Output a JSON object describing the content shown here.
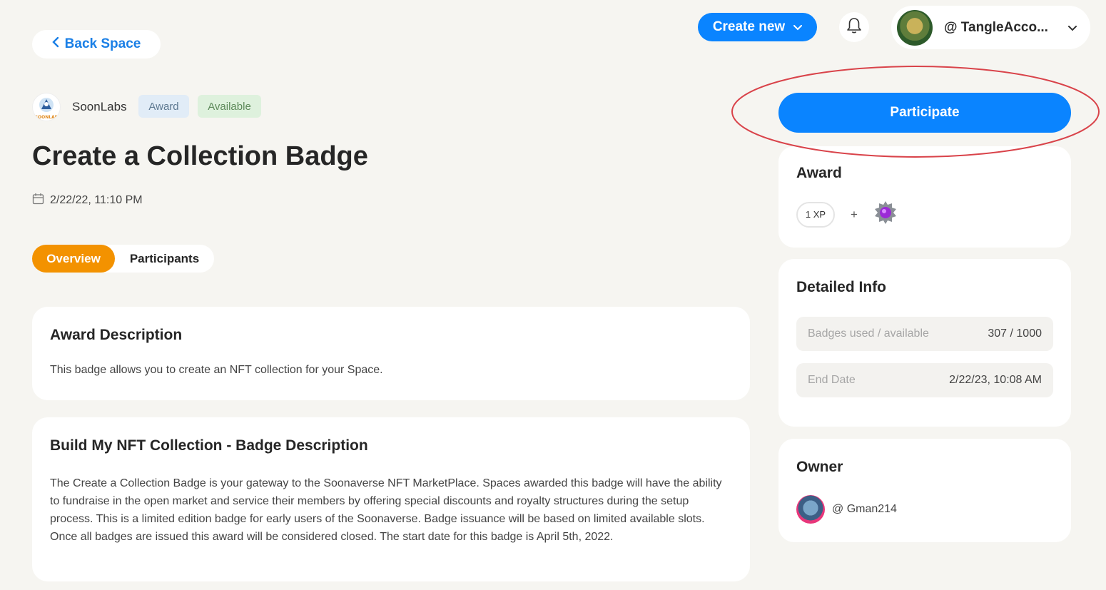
{
  "header": {
    "back_label": "Back Space",
    "create_label": "Create new",
    "account_name": "@ TangleAcco..."
  },
  "space": {
    "name": "SoonLabs",
    "logo_text": "SOONLAB",
    "tags": [
      "Award",
      "Available"
    ]
  },
  "page": {
    "title": "Create a Collection Badge",
    "date": "2/22/22, 11:10 PM"
  },
  "tabs": [
    {
      "label": "Overview",
      "active": true
    },
    {
      "label": "Participants",
      "active": false
    }
  ],
  "award_description": {
    "heading": "Award Description",
    "text": "This badge allows you to create an NFT collection for your Space."
  },
  "badge_description": {
    "heading": "Build My NFT Collection - Badge Description",
    "text": "The Create a Collection Badge is your gateway to the Soonaverse NFT MarketPlace. Spaces awarded this badge will have the ability to fundraise in the open market and service their members by offering special discounts and royalty structures during the setup process. This is a limited edition badge for early users of the Soonaverse. Badge issuance will be based on limited available slots. Once all badges are issued this award will be considered closed. The start date for this badge is April 5th, 2022."
  },
  "sidebar": {
    "participate_label": "Participate",
    "award": {
      "heading": "Award",
      "xp": "1 XP",
      "plus": "+"
    },
    "detailed_info": {
      "heading": "Detailed Info",
      "rows": [
        {
          "key": "Badges used / available",
          "value": "307 / 1000"
        },
        {
          "key": "End Date",
          "value": "2/22/23, 10:08 AM"
        }
      ]
    },
    "owner": {
      "heading": "Owner",
      "name": "@ Gman214"
    }
  },
  "colors": {
    "background": "#f6f5f1",
    "primary_blue": "#0a84ff",
    "active_tab_orange": "#f39200",
    "annotation_red": "#d9434a"
  }
}
